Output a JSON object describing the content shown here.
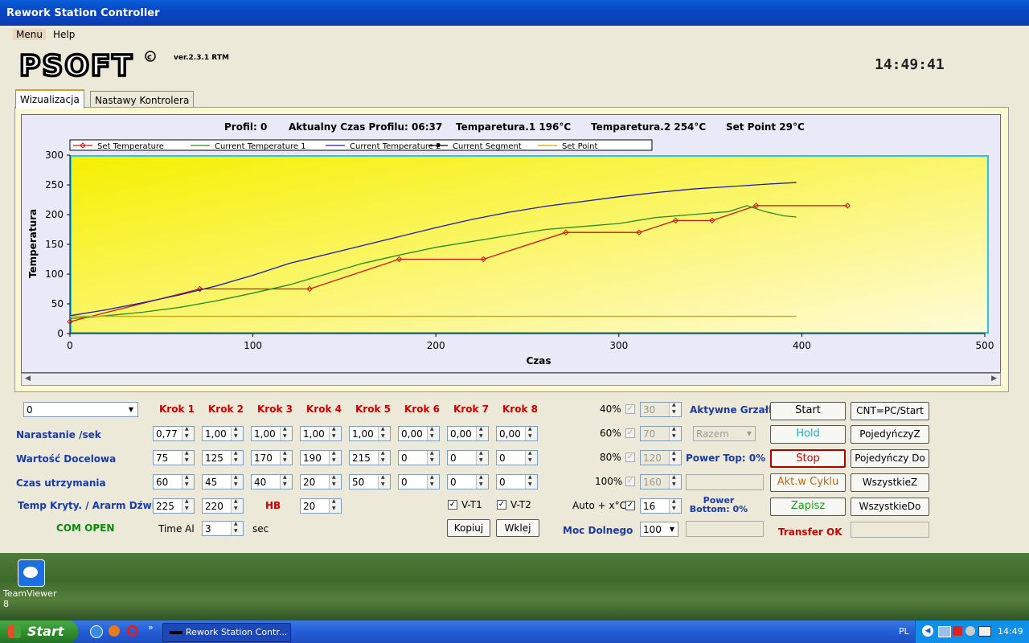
{
  "window": {
    "title": "Rework Station Controller"
  },
  "menu": {
    "items": [
      "Menu",
      "Help"
    ]
  },
  "logo_text": "PSOFT",
  "version": "ver.2.3.1 RTM",
  "clock": "14:49:41",
  "tabs": [
    "Wizualizacja",
    "Nastawy Kontrolera"
  ],
  "status_line": {
    "profil": "Profil: 0",
    "czas": "Aktualny Czas Profilu: 06:37",
    "t1": "Temparetura.1  196°C",
    "t2": "Temparetura.2  254°C",
    "setpoint": "Set Point 29°C"
  },
  "chart_data": {
    "type": "line",
    "xlabel": "Czas",
    "ylabel": "Temperatura",
    "xlim": [
      0,
      500
    ],
    "ylim": [
      0,
      300
    ],
    "xticks": [
      0,
      100,
      200,
      300,
      400,
      500
    ],
    "yticks": [
      0,
      50,
      100,
      150,
      200,
      250,
      300
    ],
    "legend_position": "top",
    "background": "yellow-gradient",
    "series": [
      {
        "name": "Set Temperature",
        "color": "#c81818",
        "marker": "diamond",
        "x": [
          0,
          71,
          131,
          180,
          226,
          271,
          311,
          331,
          351,
          375,
          425
        ],
        "y": [
          20,
          75,
          75,
          125,
          125,
          170,
          170,
          190,
          190,
          215,
          215
        ]
      },
      {
        "name": "Current Temperature 1",
        "color": "#2a8a2a",
        "x": [
          0,
          20,
          40,
          60,
          80,
          100,
          120,
          140,
          160,
          180,
          200,
          220,
          240,
          260,
          280,
          300,
          320,
          340,
          360,
          370,
          380,
          390,
          397
        ],
        "y": [
          25,
          30,
          36,
          44,
          55,
          68,
          82,
          100,
          118,
          132,
          145,
          155,
          165,
          175,
          180,
          185,
          195,
          200,
          205,
          215,
          205,
          198,
          196
        ]
      },
      {
        "name": "Current Temperature 2",
        "color": "#1a1ab0",
        "x": [
          0,
          20,
          40,
          60,
          80,
          100,
          120,
          140,
          160,
          180,
          200,
          220,
          240,
          260,
          280,
          300,
          320,
          340,
          360,
          380,
          397
        ],
        "y": [
          30,
          40,
          52,
          65,
          80,
          98,
          118,
          133,
          148,
          163,
          178,
          192,
          204,
          214,
          222,
          230,
          237,
          243,
          247,
          251,
          254
        ]
      },
      {
        "name": "Current Segment",
        "color": "#000000",
        "marker": "square",
        "x": [],
        "y": []
      },
      {
        "name": "Set Point",
        "color": "#d4a400",
        "x": [
          0,
          397
        ],
        "y": [
          29,
          29
        ]
      }
    ]
  },
  "profile_select": "0",
  "steps": [
    "Krok 1",
    "Krok 2",
    "Krok 3",
    "Krok 4",
    "Krok 5",
    "Krok 6",
    "Krok 7",
    "Krok 8"
  ],
  "rows": [
    {
      "label": "Narastanie /sek",
      "values": [
        "0,77",
        "1,00",
        "1,00",
        "1,00",
        "1,00",
        "0,00",
        "0,00",
        "0,00"
      ]
    },
    {
      "label": "Wartość Docelowa",
      "values": [
        "75",
        "125",
        "170",
        "190",
        "215",
        "0",
        "0",
        "0"
      ]
    },
    {
      "label": "Czas utrzymania",
      "values": [
        "60",
        "45",
        "40",
        "20",
        "50",
        "0",
        "0",
        "0"
      ]
    }
  ],
  "alarm": {
    "label": "Temp Kryty. / Ararm Dźwięk",
    "v1": "225",
    "v2": "220",
    "hb_label": "HB",
    "hb_value": "20"
  },
  "status_com": "COM OPEN",
  "time_al": {
    "label": "Time Al",
    "value": "3",
    "unit": "sec"
  },
  "vt": {
    "vt1": "V-T1",
    "vt2": "V-T2"
  },
  "copy_btn": "Kopiuj",
  "paste_btn": "Wklej",
  "power_levels": [
    {
      "label": "40%",
      "value": "30"
    },
    {
      "label": "60%",
      "value": "70"
    },
    {
      "label": "80%",
      "value": "120"
    },
    {
      "label": "100%",
      "value": "160"
    }
  ],
  "auto": {
    "label": "Auto + x°C",
    "value": "16"
  },
  "moc_dolnego": {
    "label": "Moc Dolnego",
    "value": "100"
  },
  "aktywne_grzalki": "Aktywne Grzałki",
  "razem": "Razem",
  "power_top": "Power Top: 0%",
  "power_bottom": "Power Bottom: 0%",
  "transfer": "Transfer OK",
  "buttons": {
    "start": "Start",
    "hold": "Hold",
    "stop": "Stop",
    "akt": "Akt.w Cyklu",
    "zapisz": "Zapisz",
    "cnt": "CNT=PC/Start",
    "pojz": "PojedyńczyZ",
    "pojdo": "Pojedyńczy Do",
    "wszz": "WszystkieZ",
    "wszdo": "WszystkieDo"
  },
  "desktop_icon": "TeamViewer 8",
  "taskbar": {
    "start": "Start",
    "task": "Rework Station Contr...",
    "lang": "PL",
    "time": "14:49"
  }
}
